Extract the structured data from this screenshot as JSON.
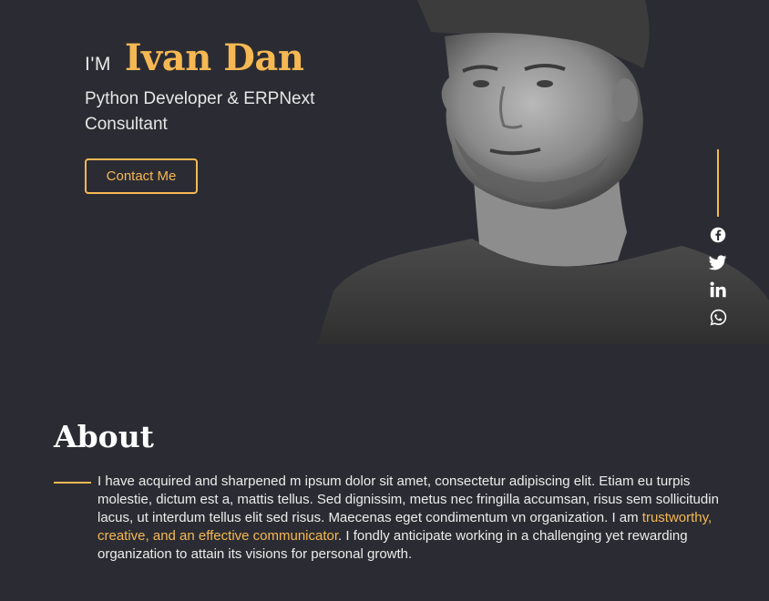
{
  "hero": {
    "greeting": "I'M",
    "name": "Ivan Dan",
    "role": "Python Developer & ERPNext Consultant",
    "contact_label": "Contact Me"
  },
  "social": {
    "items": [
      "facebook-icon",
      "twitter-icon",
      "linkedin-icon",
      "whatsapp-icon"
    ]
  },
  "about": {
    "title": "About",
    "text_before": "I have acquired and sharpened m ipsum dolor sit amet, consectetur adipiscing elit. Etiam eu turpis molestie, dictum est a, mattis tellus. Sed dignissim, metus nec fringilla accumsan, risus sem sollicitudin lacus, ut interdum tellus elit sed risus. Maecenas eget condimentum vn organization. I am ",
    "highlight": "trustworthy, creative, and an effective communicator",
    "text_after": ". I fondly anticipate working in a challenging yet rewarding organization to attain its visions for personal growth."
  },
  "colors": {
    "background": "#2b2c33",
    "accent": "#f6b852",
    "text": "#ececec"
  }
}
